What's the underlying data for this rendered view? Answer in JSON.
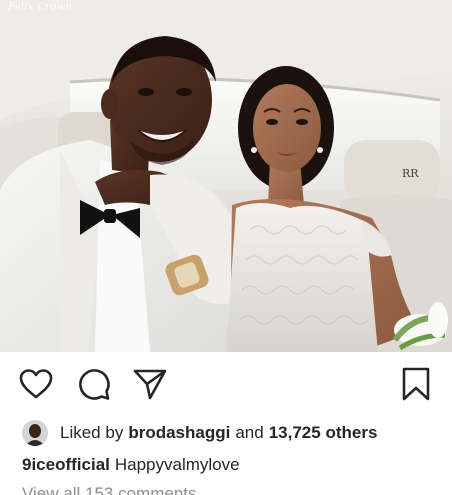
{
  "post": {
    "watermark": "Felix Crown"
  },
  "actions": {
    "like_icon": "heart-icon",
    "comment_icon": "comment-icon",
    "share_icon": "paper-plane-icon",
    "save_icon": "bookmark-icon"
  },
  "likes": {
    "prefix": "Liked by",
    "user": "brodashaggi",
    "conjunction": "and",
    "count": "13,725 others"
  },
  "caption": {
    "username": "9iceofficial",
    "text": "Happyvalmylove"
  },
  "comments": {
    "view_all": "View all 153 comments"
  },
  "colors": {
    "text": "#262626",
    "muted": "#8e8e8e",
    "background": "#ffffff"
  }
}
